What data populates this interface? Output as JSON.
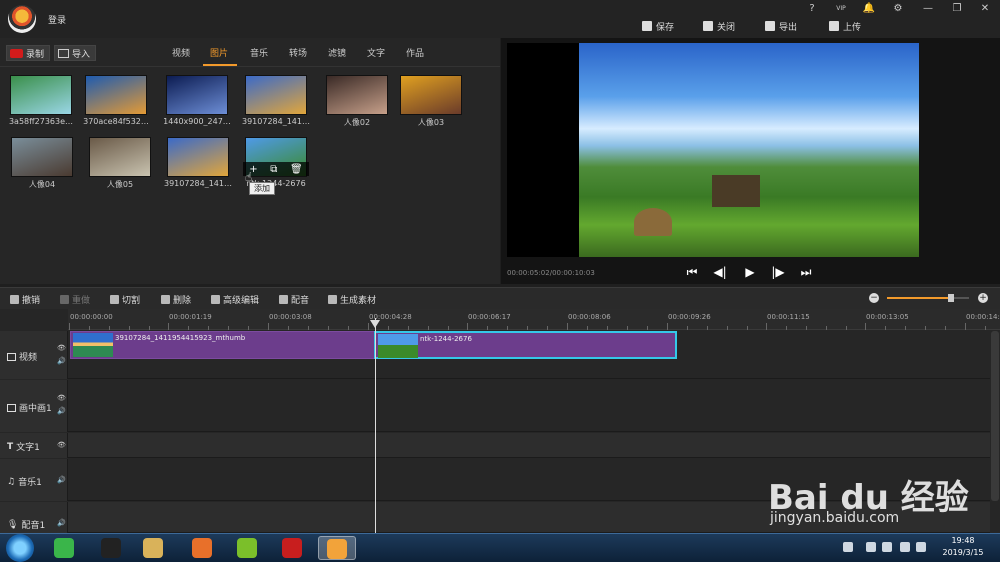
{
  "app": {
    "login": "登录"
  },
  "window_controls": [
    "?",
    "VIP",
    "🔔",
    "⚙",
    "—",
    "❐",
    "✕"
  ],
  "top_actions": [
    {
      "label": "保存",
      "icon": "save-icon"
    },
    {
      "label": "关闭",
      "icon": "close-project-icon"
    },
    {
      "label": "导出",
      "icon": "export-icon"
    },
    {
      "label": "上传",
      "icon": "upload-icon"
    }
  ],
  "media": {
    "record_label": "录制",
    "import_label": "导入",
    "tabs": [
      "视频",
      "图片",
      "音乐",
      "转场",
      "滤镜",
      "文字",
      "作品"
    ],
    "active_tab": "图片",
    "items": [
      {
        "caption": "3a58ff27363e…",
        "colors": [
          "#3a8f4a",
          "#9ad6e6"
        ]
      },
      {
        "caption": "370ace84f532…",
        "colors": [
          "#1e5bb0",
          "#e49a35"
        ]
      },
      {
        "caption": "1440x900_247…",
        "colors": [
          "#0c1c52",
          "#6d8ed6"
        ]
      },
      {
        "caption": "39107284_141…",
        "colors": [
          "#3b6ac8",
          "#e2a63b"
        ]
      },
      {
        "caption": "人像02",
        "colors": [
          "#3a2a26",
          "#c7a08a"
        ]
      },
      {
        "caption": "人像03",
        "colors": [
          "#e0a020",
          "#6a3b2a"
        ]
      },
      {
        "caption": "人像04",
        "colors": [
          "#7a8e9a",
          "#4a3a30"
        ]
      },
      {
        "caption": "人像05",
        "colors": [
          "#6a5a48",
          "#c9c3b0"
        ]
      },
      {
        "caption": "39107284_141…",
        "colors": [
          "#3b6ac8",
          "#e2a63b"
        ]
      },
      {
        "caption": "ntk-1244-2676",
        "colors": [
          "#4f9ae8",
          "#3b8a2a"
        ]
      }
    ],
    "hover_actions": [
      "+",
      "⧉",
      "🗑"
    ],
    "tooltip": "添加"
  },
  "preview": {
    "timecode": "00:00:05:02/00:00:10:03",
    "controls": [
      "⏮",
      "◀|",
      "▶",
      "|▶",
      "⏭"
    ]
  },
  "toolbar": [
    {
      "label": "撤销",
      "icon": "undo-icon",
      "enabled": true
    },
    {
      "label": "重做",
      "icon": "redo-icon",
      "enabled": false
    },
    {
      "label": "切割",
      "icon": "scissors-icon",
      "enabled": true
    },
    {
      "label": "删除",
      "icon": "trash-icon",
      "enabled": true
    },
    {
      "label": "高级编辑",
      "icon": "pencil-icon",
      "enabled": true
    },
    {
      "label": "配音",
      "icon": "microphone-icon",
      "enabled": true
    },
    {
      "label": "生成素材",
      "icon": "film-reel-icon",
      "enabled": true
    }
  ],
  "zoom": {
    "minus": "−",
    "plus": "+",
    "level": 0.78
  },
  "ruler": [
    "00:00:00:00",
    "00:00:01:19",
    "00:00:03:08",
    "00:00:04:28",
    "00:00:06:17",
    "00:00:08:06",
    "00:00:09:26",
    "00:00:11:15",
    "00:00:13:05",
    "00:00:14:"
  ],
  "tracks": [
    {
      "label": "视频",
      "icons": [
        "👁",
        "🔊"
      ]
    },
    {
      "label": "画中画1",
      "icons": [
        "👁",
        "🔊"
      ]
    },
    {
      "label": "文字1",
      "icons": [
        "👁"
      ]
    },
    {
      "label": "音乐1",
      "icons": [
        "🔊"
      ]
    },
    {
      "label": "配音1",
      "icons": [
        "🔊"
      ]
    }
  ],
  "clips": [
    {
      "label": "39107284_1411954415923_mthumb",
      "selected": false
    },
    {
      "label": "ntk-1244-2676",
      "selected": true
    }
  ],
  "watermark": {
    "main": "Bai du 经验",
    "sub": "jingyan.baidu.com"
  },
  "taskbar": {
    "time": "19:48",
    "date": "2019/3/15",
    "apps": [
      {
        "color": "#3ab54a"
      },
      {
        "color": "#222222"
      },
      {
        "color": "#d9b25a"
      },
      {
        "color": "#e8702a"
      },
      {
        "color": "#7bbf2a"
      },
      {
        "color": "#c81e1e"
      },
      {
        "color": "#f2a33a"
      }
    ]
  }
}
